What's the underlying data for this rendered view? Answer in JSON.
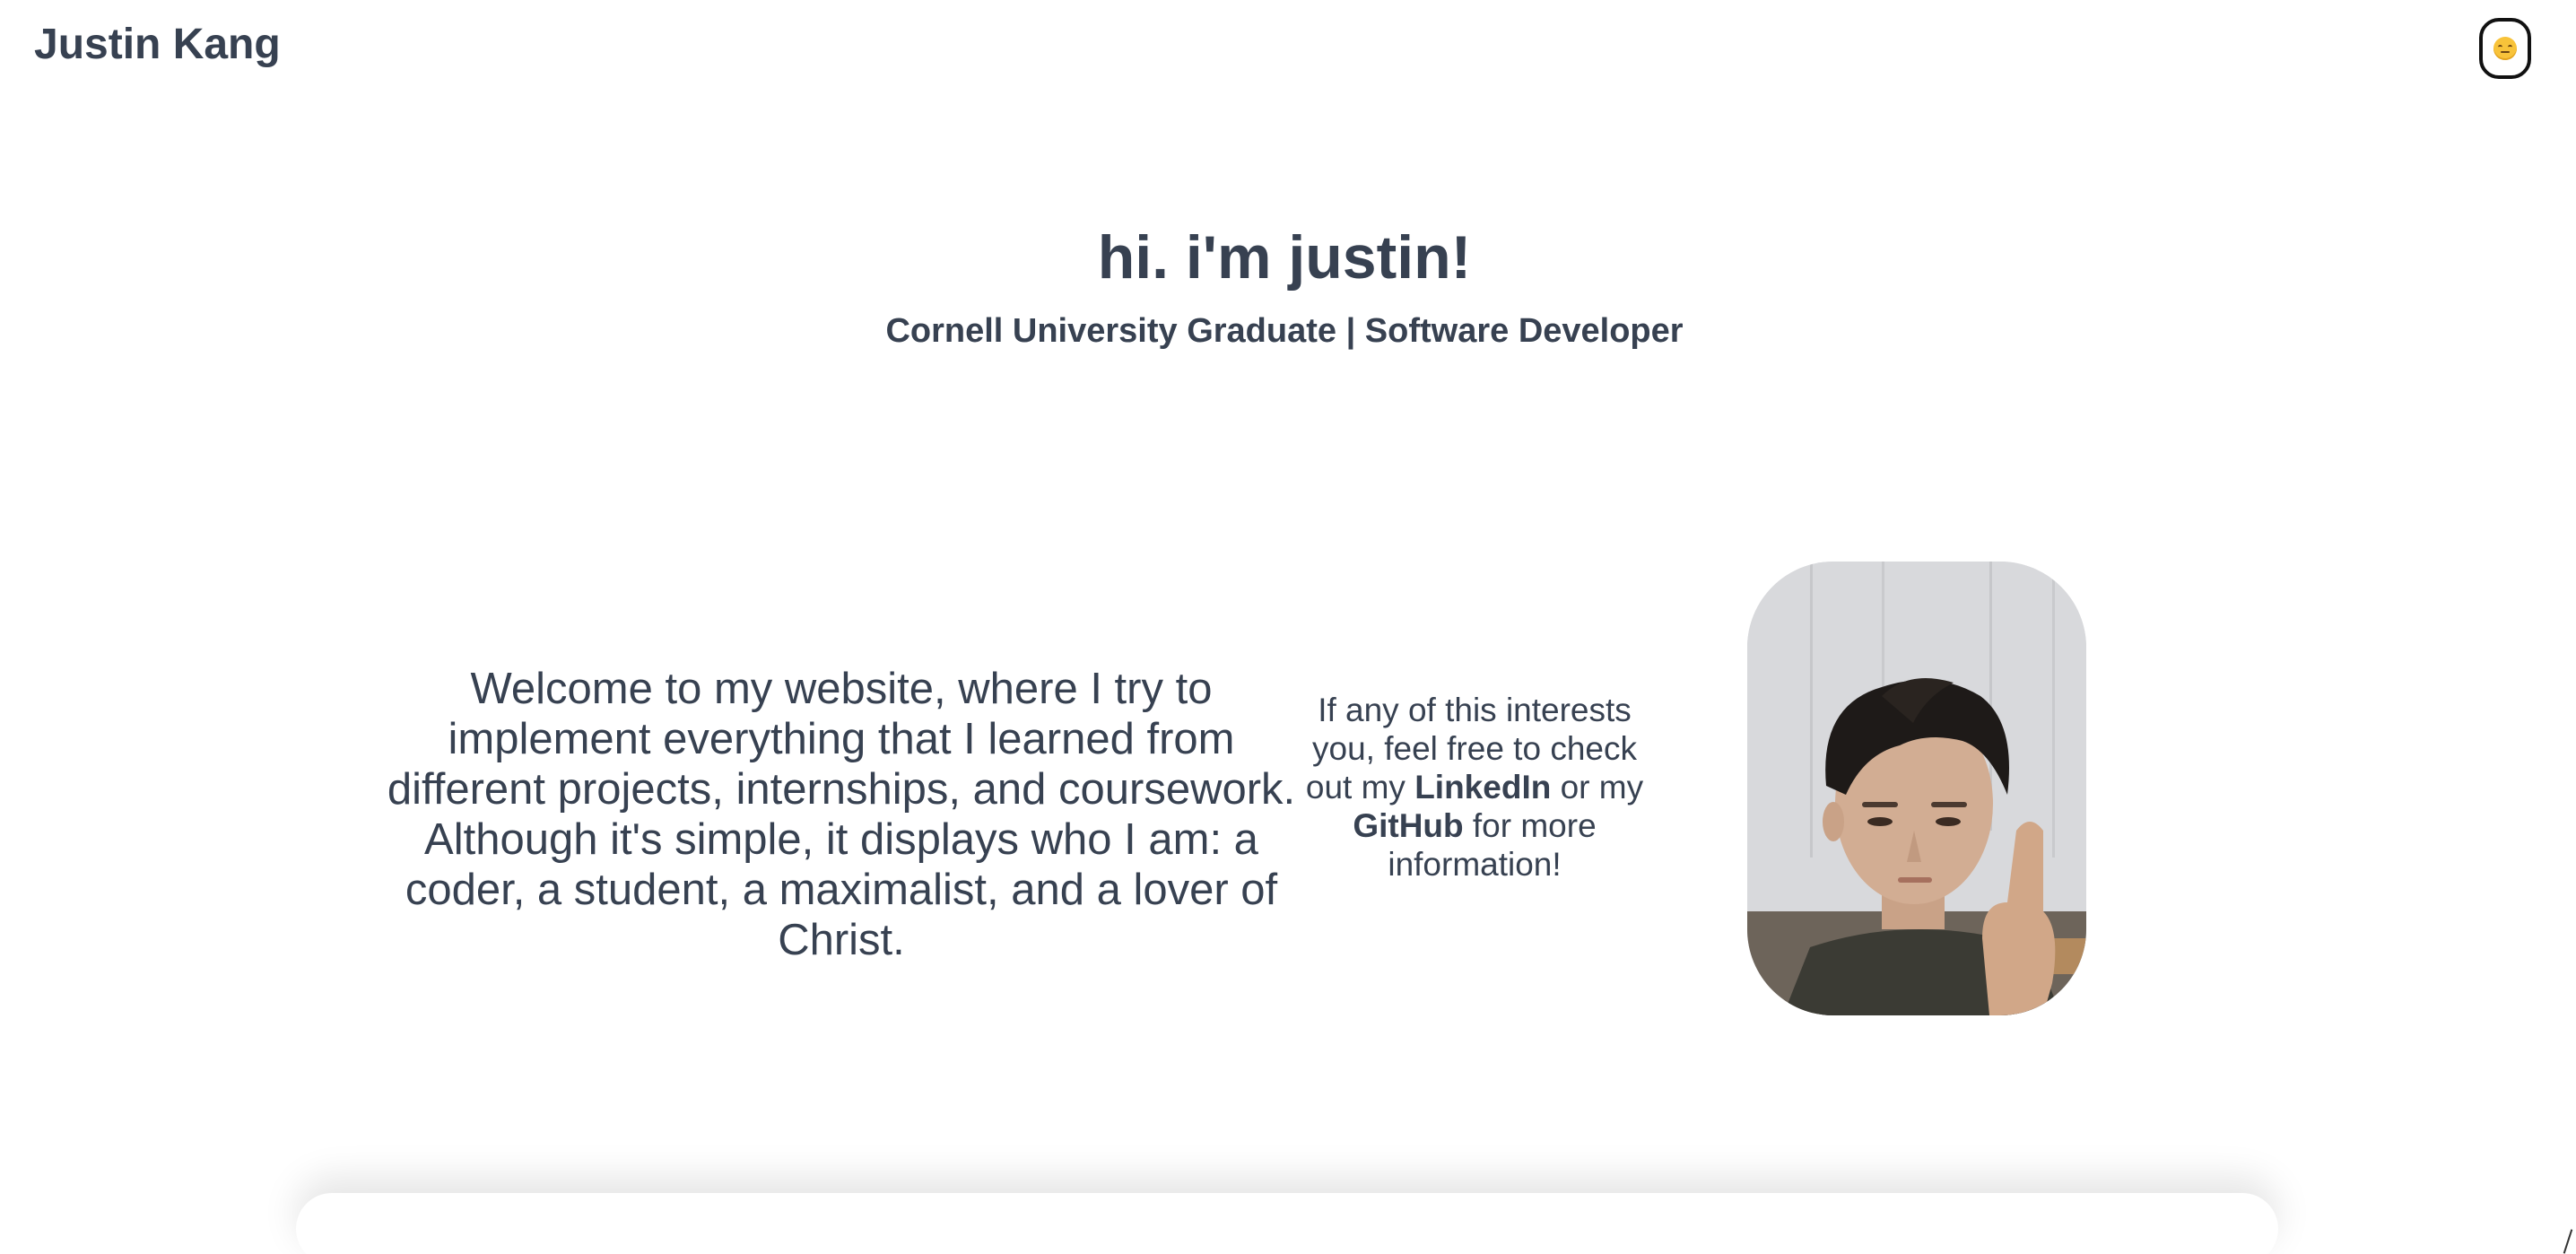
{
  "header": {
    "site_name": "Justin Kang",
    "theme_toggle_icon": "emoji-face-icon"
  },
  "hero": {
    "title": "hi. i'm justin!",
    "subtitle": "Cornell University Graduate | Software Developer"
  },
  "intro": {
    "welcome_text": "Welcome to my website, where I try to implement everything that I learned from different projects, internships, and coursework. Although it's simple, it displays who I am: a coder, a student, a maximalist, and a lover of Christ.",
    "cta_before": "If any of this interests you, feel free to check out my ",
    "linkedin_label": "LinkedIn",
    "cta_middle": " or my ",
    "github_label": "GitHub",
    "cta_after": " for more information!"
  },
  "colors": {
    "text": "#374151",
    "background": "#ffffff"
  }
}
